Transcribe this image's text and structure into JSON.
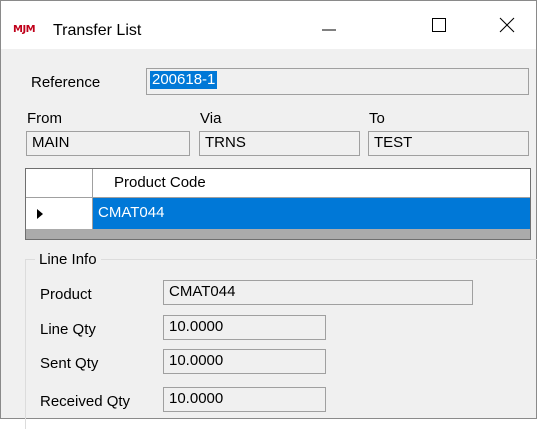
{
  "window": {
    "title": "Transfer List",
    "app_icon_text": "MJM",
    "controls": {
      "minimize": "minimize",
      "maximize": "maximize",
      "close": "close"
    }
  },
  "reference": {
    "label": "Reference",
    "value": "200618-1"
  },
  "route": {
    "from": {
      "label": "From",
      "value": "MAIN"
    },
    "via": {
      "label": "Via",
      "value": "TRNS"
    },
    "to": {
      "label": "To",
      "value": "TEST"
    }
  },
  "grid": {
    "columns": [
      "Product Code"
    ],
    "rows": [
      {
        "product_code": "CMAT044",
        "selected": true
      }
    ]
  },
  "line_info": {
    "title": "Line Info",
    "product": {
      "label": "Product",
      "value": "CMAT044"
    },
    "line_qty": {
      "label": "Line Qty",
      "value": "10.0000"
    },
    "sent_qty": {
      "label": "Sent Qty",
      "value": "10.0000"
    },
    "received_qty": {
      "label": "Received Qty",
      "value": "10.0000"
    }
  },
  "colors": {
    "selection": "#0078d7",
    "app_icon": "#c0001a",
    "window_bg": "#f0f0f0"
  }
}
